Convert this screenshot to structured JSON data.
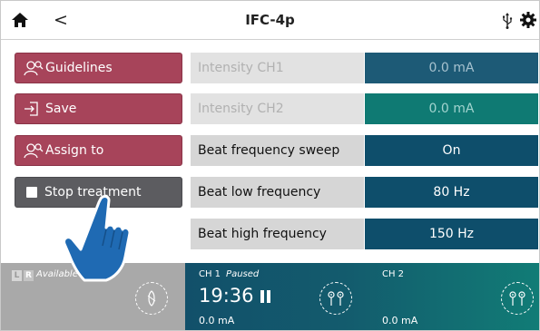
{
  "header": {
    "title": "IFC-4p",
    "back_glyph": "<",
    "icons": [
      "home-icon",
      "chevron-left-icon",
      "usb-icon",
      "gear-icon"
    ]
  },
  "left_buttons": [
    {
      "label": "Guidelines",
      "icon": "guidelines-icon",
      "style": "red"
    },
    {
      "label": "Save",
      "icon": "save-icon",
      "style": "red"
    },
    {
      "label": "Assign to",
      "icon": "assign-icon",
      "style": "red"
    },
    {
      "label": "Stop treatment",
      "icon": "checkbox-icon",
      "style": "dark"
    }
  ],
  "settings": [
    {
      "label": "Intensity CH1",
      "value": "0.0 mA",
      "enabled": false
    },
    {
      "label": "Intensity CH2",
      "value": "0.0 mA",
      "enabled": false
    },
    {
      "label": "Beat frequency sweep",
      "value": "On",
      "enabled": true
    },
    {
      "label": "Beat low frequency",
      "value": "80 Hz",
      "enabled": true
    },
    {
      "label": "Beat high frequency",
      "value": "150 Hz",
      "enabled": true
    }
  ],
  "bottom_bar": {
    "left_slot": {
      "l_tag": "L",
      "r_tag": "R",
      "status": "Available"
    },
    "ch1": {
      "label": "CH 1",
      "status": "Paused",
      "timer": "19:36",
      "value": "0.0 mA"
    },
    "ch2": {
      "label": "CH 2",
      "value": "0.0 mA"
    }
  },
  "colors": {
    "accent_red": "#a7445a",
    "stop_button": "#5c5c60",
    "value_blue": "#0e4e6b",
    "value_teal": "#0f7a73",
    "bar_gradient_start": "#12506a",
    "bar_gradient_end": "#117c76"
  }
}
